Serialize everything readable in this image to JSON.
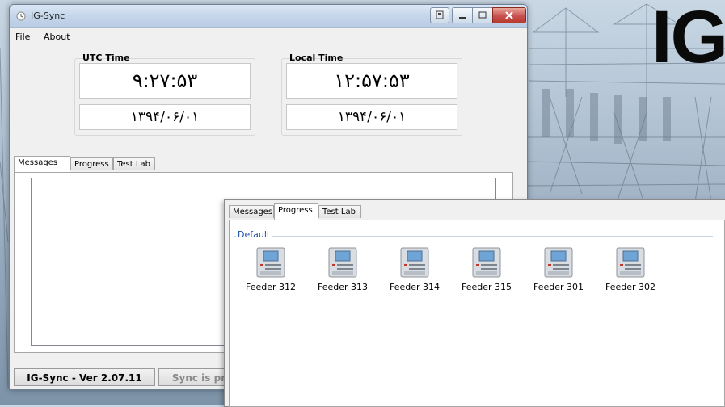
{
  "brand_text": "IG",
  "window": {
    "title": "IG-Sync",
    "menu": [
      "File",
      "About"
    ]
  },
  "clocks": {
    "utc": {
      "label": "UTC Time",
      "time": "۹:۲۷:۵۳",
      "date": "۱۳۹۴/۰۶/۰۱"
    },
    "local": {
      "label": "Local Time",
      "time": "۱۲:۵۷:۵۳",
      "date": "۱۳۹۴/۰۶/۰۱"
    }
  },
  "tabs": [
    "Messages",
    "Progress",
    "Test Lab"
  ],
  "status": {
    "version": "IG-Sync - Ver 2.07.11",
    "sync_text": "Sync is pr"
  },
  "progress_panel": {
    "tabs": [
      "Messages",
      "Progress",
      "Test Lab"
    ],
    "group_label": "Default",
    "devices": [
      "Feeder 312",
      "Feeder 313",
      "Feeder 314",
      "Feeder 315",
      "Feeder 301",
      "Feeder 302"
    ]
  },
  "colors": {
    "group_label": "#1c4fa8",
    "close_button": "#c75050",
    "device_screen": "#6fa5d6"
  }
}
